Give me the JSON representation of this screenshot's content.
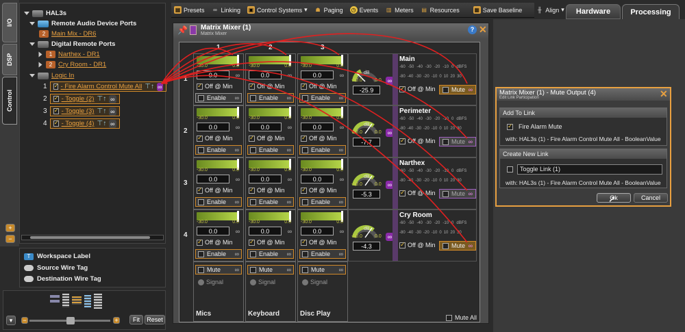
{
  "left_tabs": [
    "I/O",
    "DSP",
    "Control"
  ],
  "tree": {
    "root": "HAL3s",
    "remote_audio": "Remote Audio Device Ports",
    "main_mix_badge": "2",
    "main_mix": "Main Mix - DR6",
    "digital_remote": "Digital Remote Ports",
    "narthex_badge": "1",
    "narthex": "Narthex - DR1",
    "cry_badge": "2",
    "cry_room": "Cry Room - DR1",
    "logic_in": "Logic In",
    "logic_items": [
      {
        "num": "1",
        "label": "- Fire Alarm Control Mute All"
      },
      {
        "num": "2",
        "label": "- Toggle (2)"
      },
      {
        "num": "3",
        "label": "- Toggle (3)"
      },
      {
        "num": "4",
        "label": "- Toggle (4)"
      }
    ]
  },
  "legend_panel": {
    "workspace_label": "Workspace Label",
    "source_wire_tag": "Source Wire Tag",
    "destination_wire_tag": "Destination Wire Tag",
    "ws_icon": "T"
  },
  "zoom_panel": {
    "fit": "Fit",
    "reset": "Reset"
  },
  "toolbar": {
    "presets": "Presets",
    "linking": "Linking",
    "control_systems": "Control Systems",
    "paging": "Paging",
    "events": "Events",
    "meters": "Meters",
    "resources": "Resources",
    "save_baseline": "Save Baseline",
    "align": "Align"
  },
  "top_tabs": {
    "hardware": "Hardware",
    "processing": "Processing"
  },
  "matrix": {
    "title": "Matrix Mixer (1)",
    "subtitle": "Matrix Mixer",
    "col_headers": [
      "1",
      "2",
      "3"
    ],
    "row_headers": [
      "1",
      "2",
      "3",
      "4"
    ],
    "fader_ticks": [
      "-30.0",
      "0.0"
    ],
    "cross_value": "0.0",
    "off_min": "Off @ Min",
    "enable": "Enable",
    "mute": "Mute",
    "signal": "Signal",
    "inputs": [
      "Mics",
      "Keyboard",
      "Disc Play"
    ],
    "dB": "dB",
    "knob_ticks": [
      "-30.0",
      "0.0"
    ],
    "scale": [
      "-60",
      "-50",
      "-40",
      "-30",
      "-20",
      "-10",
      "0",
      "dBFS"
    ],
    "scale2": [
      "-80",
      "-40",
      "-30",
      "-20",
      "-10",
      "0",
      "10",
      "20",
      "30"
    ],
    "outputs": [
      {
        "name": "Main",
        "value": "-25.9",
        "mute_hot": true
      },
      {
        "name": "Perimeter",
        "value": "-7.7",
        "mute_hot": false
      },
      {
        "name": "Narthex",
        "value": "-5.3",
        "mute_hot": false
      },
      {
        "name": "Cry Room",
        "value": "-4.3",
        "mute_hot": true
      }
    ],
    "mute_all": "Mute All"
  },
  "dialog": {
    "title": "Matrix Mixer (1) - Mute Output (4)",
    "subtitle": "Edit Link Participation",
    "add_to_link": "Add To Link",
    "fire_alarm_mute": "Fire Alarm Mute",
    "with_line_1": "with: HAL3s (1) - Fire Alarm Control Mute All - BooleanValue",
    "create_new_link": "Create New Link",
    "toggle_link_value": "Toggle Link (1)",
    "with_line_2": "with: HAL3s (1) - Fire Alarm Control Mute All - BooleanValue",
    "ok": "Ok",
    "cancel": "Cancel"
  },
  "colors": {
    "accent_orange": "#e8a040",
    "link_purple": "#8a2aa8",
    "wire_red": "#e02020",
    "fader_green": "#9ac030"
  }
}
